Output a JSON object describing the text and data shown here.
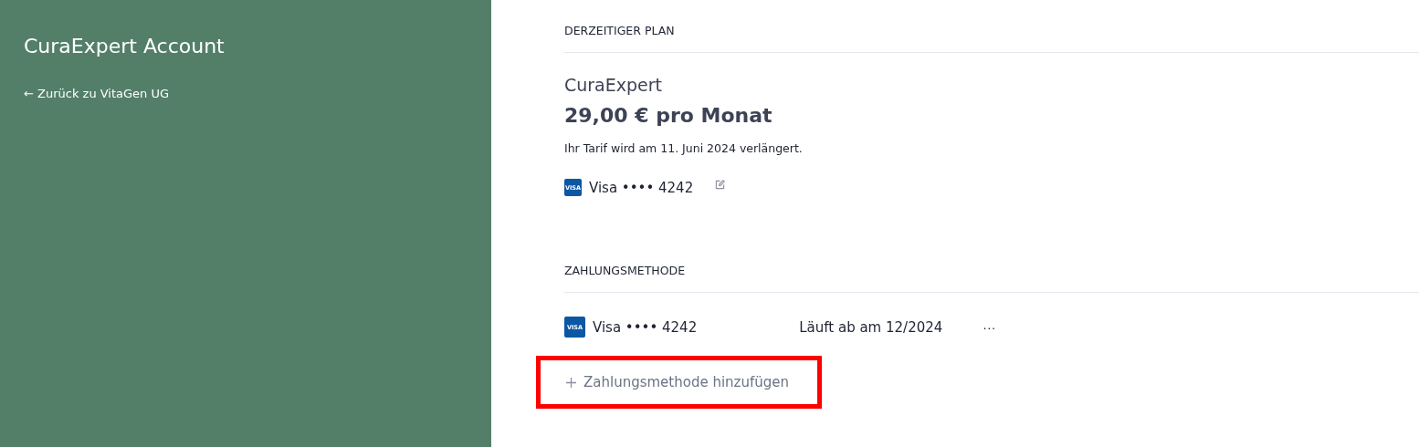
{
  "sidebar": {
    "title": "CuraExpert Account",
    "back_link": "← Zurück zu VitaGen UG"
  },
  "current_plan": {
    "heading": "DERZEITIGER PLAN",
    "plan_name": "CuraExpert",
    "price": "29,00 € pro Monat",
    "renewal_note": "Ihr Tarif wird am 11. Juni 2024 verlängert.",
    "card": {
      "brand_label": "VISA",
      "label": "Visa •••• 4242"
    }
  },
  "payment_methods": {
    "heading": "ZAHLUNGSMETHODE",
    "methods": [
      {
        "brand_label": "VISA",
        "label": "Visa •••• 4242",
        "expiry": "Läuft ab am 12/2024",
        "menu": "···"
      }
    ],
    "add_button": {
      "label": "Zahlungsmethode hinzufügen",
      "highlighted": true
    }
  }
}
